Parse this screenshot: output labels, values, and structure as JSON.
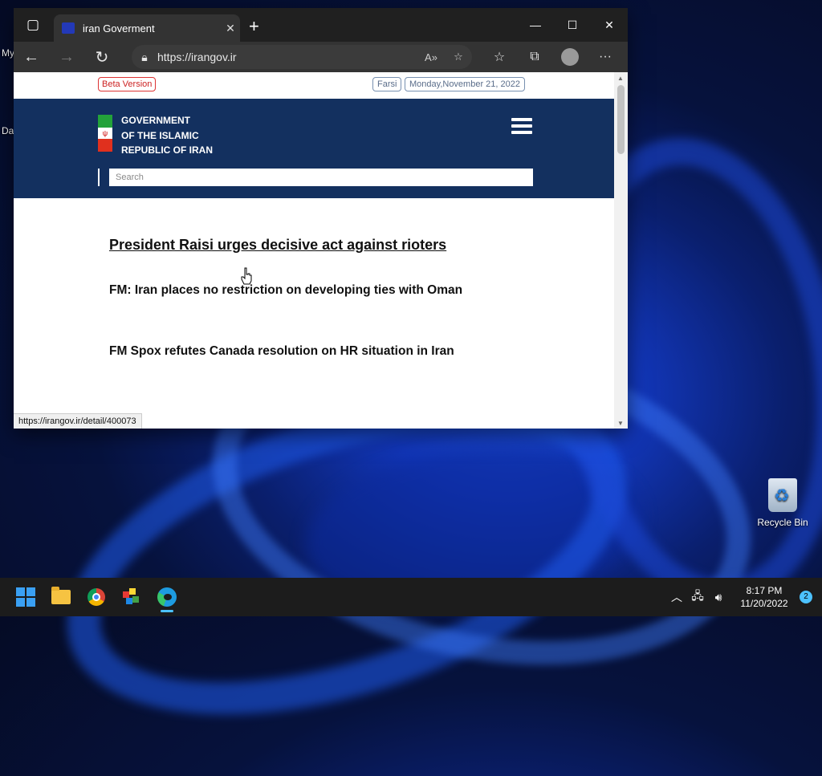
{
  "desktop": {
    "left_label_1": "My",
    "left_label_2": "Da",
    "recycle_bin_label": "Recycle Bin"
  },
  "browser": {
    "tab_title": "iran Goverment",
    "address_url": "https://irangov.ir",
    "status_url": "https://irangov.ir/detail/400073"
  },
  "page": {
    "beta_label": "Beta Version",
    "farsi_label": "Farsi",
    "date_label": "Monday,November 21, 2022",
    "gov_title_lines": [
      "GOVERNMENT",
      "OF THE ISLAMIC",
      "REPUBLIC OF IRAN"
    ],
    "search_placeholder": "Search",
    "headlines": [
      "President Raisi urges decisive act against rioters",
      "FM: Iran places no restriction on developing ties with Oman",
      "FM Spox refutes Canada resolution on HR situation in Iran"
    ]
  },
  "taskbar": {
    "time": "8:17 PM",
    "date": "11/20/2022",
    "notification_count": "2"
  },
  "colors": {
    "header_bg": "#13305f",
    "beta_border": "#dd3333",
    "taskbar_bg": "#1c1c1c",
    "accent": "#4cc2ff"
  }
}
